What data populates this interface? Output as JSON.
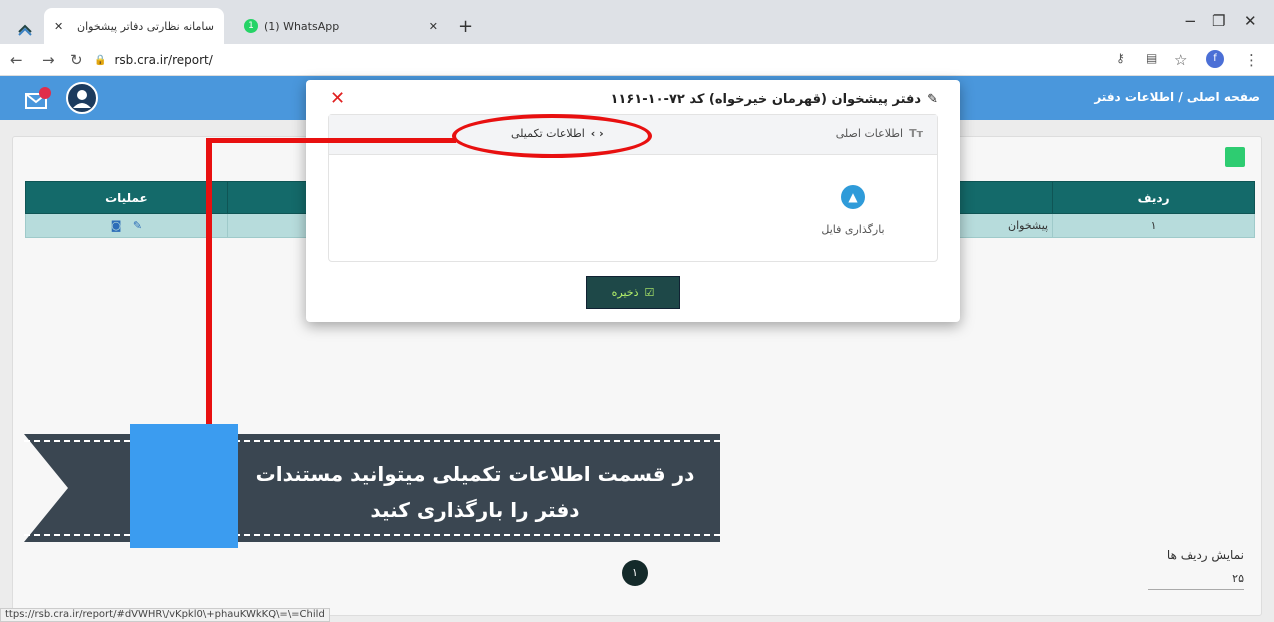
{
  "browser": {
    "tabs": [
      {
        "title": "سامانه نظارتی دفاتر پیشخوان",
        "active": true
      },
      {
        "title": "(1) WhatsApp",
        "active": false
      }
    ],
    "close_glyph": "✕",
    "new_tab_glyph": "+",
    "url": "rsb.cra.ir/report/",
    "status_url": "ttps://rsb.cra.ir/report/#dVWHR\\/vKpkl0\\+phauKWkKQ\\=\\=Child"
  },
  "app": {
    "breadcrumb": "صفحه اصلی / اطلاعات دفتر",
    "table": {
      "headers": [
        "ردیف",
        "",
        "",
        "عملیات"
      ],
      "row": {
        "index": "۱",
        "name": "پیشخوان"
      }
    },
    "pagination": {
      "page": "۱"
    },
    "rows_per_page_label": "نمایش ردیف ها",
    "rows_per_page_value": "۲۵"
  },
  "modal": {
    "title": "دفتر پیشخوان (قهرمان خیرخواه) کد ۷۲-۱۰-۱۱۶۱",
    "tab_main": "اطلاعات اصلی",
    "tab_extra": "اطلاعات تکمیلی",
    "upload_label": "بارگذاری فایل",
    "save_label": "ذخیره"
  },
  "annotation": {
    "text": "در قسمت  اطلاعات تکمیلی میتوانید مستندات دفتر را بارگذاری کنید"
  },
  "colors": {
    "appbar": "#4a97dc",
    "table_header": "#146a6a",
    "annotation_red": "#e81010",
    "banner": "#3a4651",
    "banner_accent": "#3b9cf0"
  }
}
